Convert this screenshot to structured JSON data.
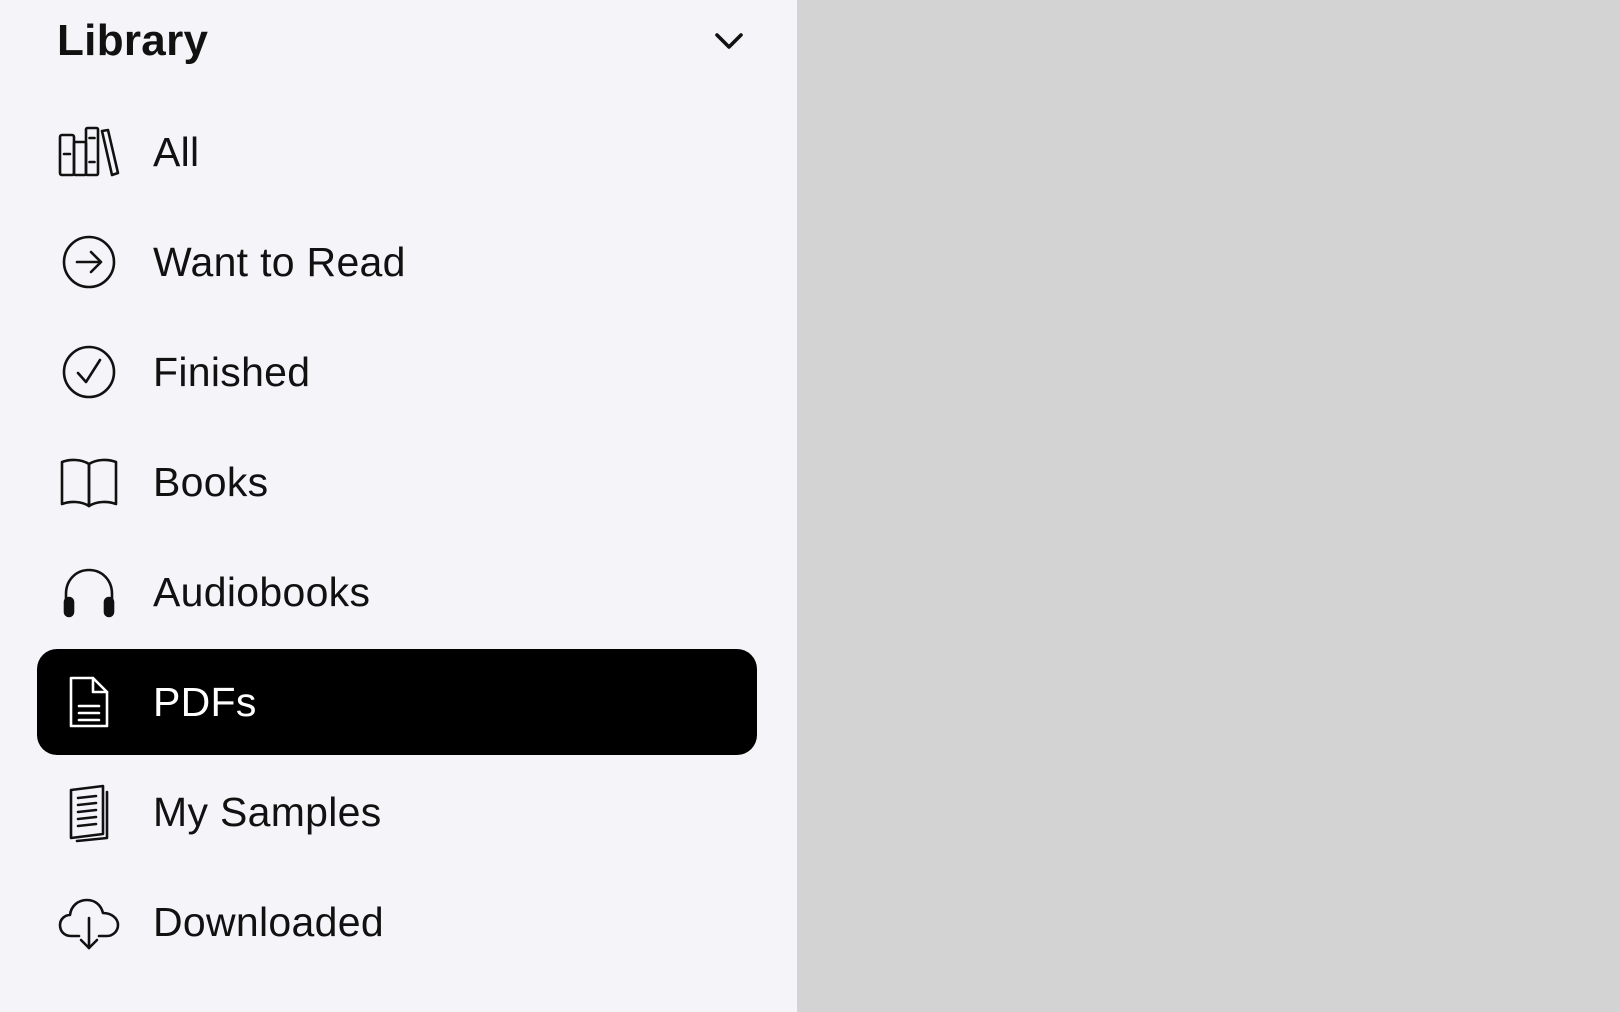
{
  "sidebar": {
    "title": "Library",
    "items": [
      {
        "label": "All",
        "icon": "bookshelf-icon",
        "selected": false
      },
      {
        "label": "Want to Read",
        "icon": "arrow-right-circle-icon",
        "selected": false
      },
      {
        "label": "Finished",
        "icon": "checkmark-circle-icon",
        "selected": false
      },
      {
        "label": "Books",
        "icon": "open-book-icon",
        "selected": false
      },
      {
        "label": "Audiobooks",
        "icon": "headphones-icon",
        "selected": false
      },
      {
        "label": "PDFs",
        "icon": "document-icon",
        "selected": true
      },
      {
        "label": "My Samples",
        "icon": "sample-pages-icon",
        "selected": false
      },
      {
        "label": "Downloaded",
        "icon": "cloud-download-icon",
        "selected": false
      }
    ]
  },
  "colors": {
    "sidebar_background": "#f5f4f9",
    "content_background": "#d3d3d3",
    "selected_background": "#000000",
    "selected_text": "#ffffff",
    "text": "#111111"
  }
}
